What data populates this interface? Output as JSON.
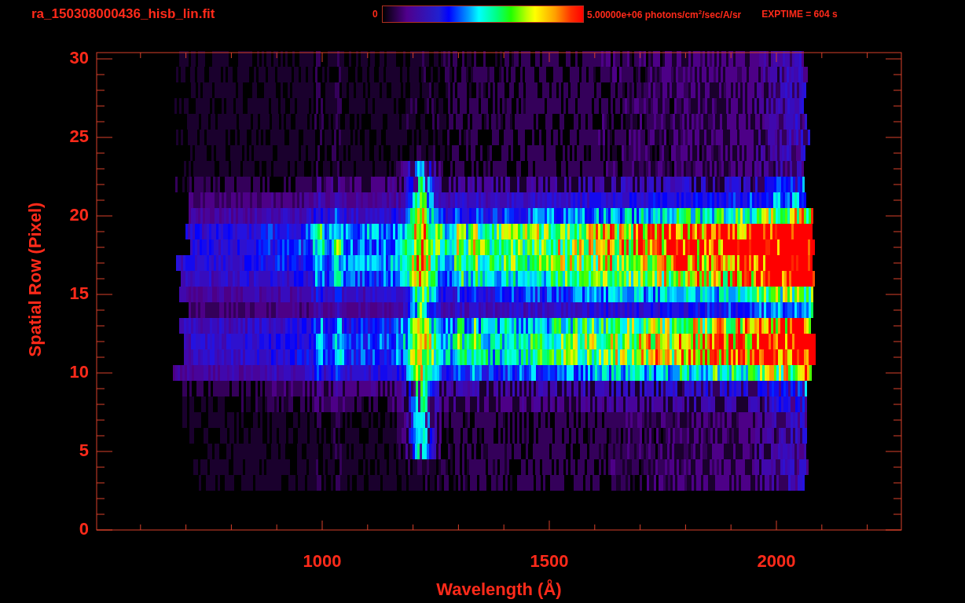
{
  "header": {
    "title": "ra_150308000436_hisb_lin.fit",
    "colorbar": {
      "min_label": "0",
      "max_label": "5.00000e+06 photons/cm$^{2}$/sec/A/sr"
    },
    "exposure": "EXPTIME = 604 s"
  },
  "plot": {
    "xlabel": "Wavelength (Å)",
    "ylabel": "Spatial Row (Pixel)",
    "xticks": [
      "1000",
      "1500",
      "2000"
    ],
    "yticks": [
      "30",
      "25",
      "20",
      "15",
      "10",
      "5",
      "0"
    ]
  }
}
